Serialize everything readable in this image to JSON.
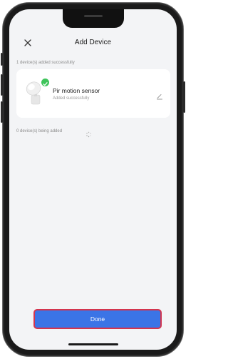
{
  "header": {
    "title": "Add Device",
    "close_icon": "close-icon"
  },
  "added_section": {
    "status_text": "1 device(s) added successfully",
    "devices": [
      {
        "name": "Pir motion sensor",
        "status": "Added successfully",
        "badge_icon": "check-icon",
        "action_icon": "edit-icon"
      }
    ]
  },
  "adding_section": {
    "status_text": "0 device(s) being added",
    "icon": "spinner-icon"
  },
  "footer": {
    "done_label": "Done"
  },
  "colors": {
    "primary_button": "#3b74e6",
    "highlight_border": "#d4354e",
    "success_badge": "#3ec45a",
    "screen_background": "#f3f4f6"
  }
}
